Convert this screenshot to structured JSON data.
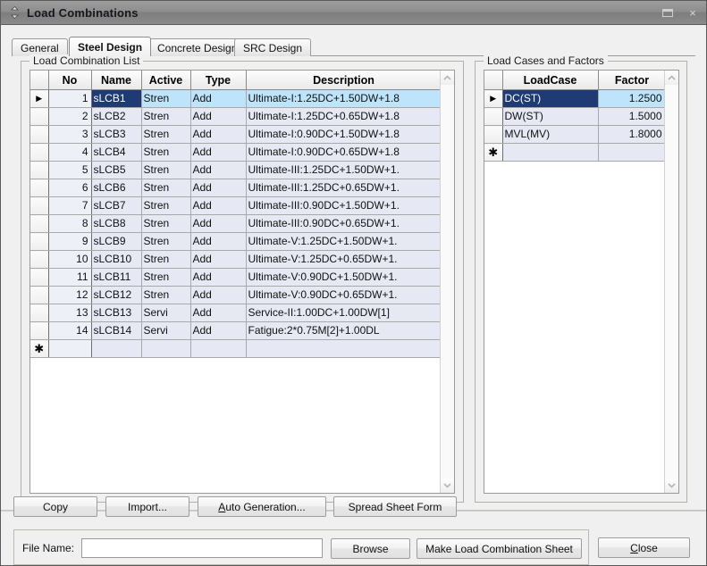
{
  "window": {
    "title": "Load Combinations",
    "icon": "updown-arrows-icon",
    "minimize_label": "_",
    "close_label": "×"
  },
  "tabs": [
    {
      "label": "General",
      "active": false
    },
    {
      "label": "Steel Design",
      "active": true
    },
    {
      "label": "Concrete Design",
      "active": false
    },
    {
      "label": "SRC Design",
      "active": false
    }
  ],
  "load_combination_list": {
    "title": "Load Combination List",
    "columns": [
      "",
      "No",
      "Name",
      "Active",
      "Type",
      "Description"
    ],
    "rows": [
      {
        "no": "1",
        "name": "sLCB1",
        "active": "Stren",
        "type": "Add",
        "description": "Ultimate-I:1.25DC+1.50DW+1.8"
      },
      {
        "no": "2",
        "name": "sLCB2",
        "active": "Stren",
        "type": "Add",
        "description": "Ultimate-I:1.25DC+0.65DW+1.8"
      },
      {
        "no": "3",
        "name": "sLCB3",
        "active": "Stren",
        "type": "Add",
        "description": "Ultimate-I:0.90DC+1.50DW+1.8"
      },
      {
        "no": "4",
        "name": "sLCB4",
        "active": "Stren",
        "type": "Add",
        "description": "Ultimate-I:0.90DC+0.65DW+1.8"
      },
      {
        "no": "5",
        "name": "sLCB5",
        "active": "Stren",
        "type": "Add",
        "description": "Ultimate-III:1.25DC+1.50DW+1."
      },
      {
        "no": "6",
        "name": "sLCB6",
        "active": "Stren",
        "type": "Add",
        "description": "Ultimate-III:1.25DC+0.65DW+1."
      },
      {
        "no": "7",
        "name": "sLCB7",
        "active": "Stren",
        "type": "Add",
        "description": "Ultimate-III:0.90DC+1.50DW+1."
      },
      {
        "no": "8",
        "name": "sLCB8",
        "active": "Stren",
        "type": "Add",
        "description": "Ultimate-III:0.90DC+0.65DW+1."
      },
      {
        "no": "9",
        "name": "sLCB9",
        "active": "Stren",
        "type": "Add",
        "description": "Ultimate-V:1.25DC+1.50DW+1."
      },
      {
        "no": "10",
        "name": "sLCB10",
        "active": "Stren",
        "type": "Add",
        "description": "Ultimate-V:1.25DC+0.65DW+1."
      },
      {
        "no": "11",
        "name": "sLCB11",
        "active": "Stren",
        "type": "Add",
        "description": "Ultimate-V:0.90DC+1.50DW+1."
      },
      {
        "no": "12",
        "name": "sLCB12",
        "active": "Stren",
        "type": "Add",
        "description": "Ultimate-V:0.90DC+0.65DW+1."
      },
      {
        "no": "13",
        "name": "sLCB13",
        "active": "Servi",
        "type": "Add",
        "description": "Service-II:1.00DC+1.00DW[1]"
      },
      {
        "no": "14",
        "name": "sLCB14",
        "active": "Servi",
        "type": "Add",
        "description": "Fatigue:2*0.75M[2]+1.00DL"
      }
    ],
    "selected_row_index": 0,
    "active_cell_column": "name",
    "row_marker": "▶",
    "new_row_marker": "✱"
  },
  "load_cases_and_factors": {
    "title": "Load Cases and Factors",
    "columns": [
      "",
      "LoadCase",
      "Factor"
    ],
    "rows": [
      {
        "loadcase": "DC(ST)",
        "factor": "1.2500"
      },
      {
        "loadcase": "DW(ST)",
        "factor": "1.5000"
      },
      {
        "loadcase": "MVL(MV)",
        "factor": "1.8000"
      }
    ],
    "selected_row_index": 0,
    "active_cell_column": "loadcase",
    "row_marker": "▶",
    "new_row_marker": "✱"
  },
  "action_buttons": {
    "copy": "Copy",
    "import": "Import...",
    "auto_generation_prefix": "A",
    "auto_generation_rest": "uto Generation...",
    "spread_sheet_form": "Spread Sheet Form"
  },
  "file_row": {
    "label": "File Name:",
    "value": "",
    "placeholder": "",
    "browse": "Browse",
    "make_sheet": "Make Load Combination Sheet"
  },
  "close_button": {
    "prefix": "C",
    "rest": "lose"
  },
  "scrollbars": {
    "up_arrow": "⌃",
    "down_arrow": "⌄"
  },
  "colors": {
    "selected_cell": "#1f3b73",
    "row_highlight": "#bde4fb",
    "row_background": "#e6e9f4",
    "window_chrome": "#f0f0f0"
  }
}
